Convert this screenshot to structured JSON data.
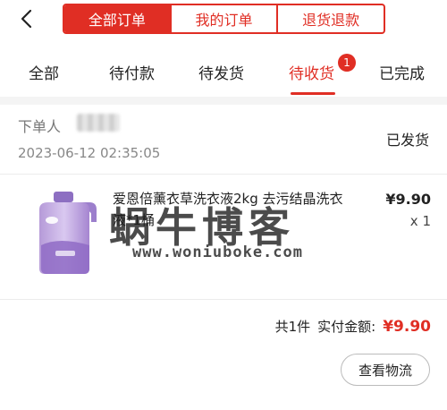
{
  "header": {
    "segments": [
      {
        "label": "全部订单",
        "active": true
      },
      {
        "label": "我的订单",
        "active": false
      },
      {
        "label": "退货退款",
        "active": false
      }
    ]
  },
  "tabs": [
    {
      "label": "全部"
    },
    {
      "label": "待付款"
    },
    {
      "label": "待发货"
    },
    {
      "label": "待收货",
      "active": true,
      "badge": "1"
    },
    {
      "label": "已完成"
    }
  ],
  "order": {
    "buyer_label": "下单人",
    "time": "2023-06-12 02:35:05",
    "status": "已发货",
    "product": {
      "title": "爱恩倍薰衣草洗衣液2kg 去污结晶洗衣液*1桶",
      "price": "¥9.90",
      "qty": "x 1"
    },
    "summary": {
      "count": "共1件",
      "paid_label": "实付金额:",
      "paid_amount": "¥9.90"
    },
    "logistics_button": "查看物流"
  },
  "watermark": {
    "big": "蜗牛博客",
    "small": "www.woniuboke.com"
  },
  "colors": {
    "accent": "#e02e24"
  }
}
